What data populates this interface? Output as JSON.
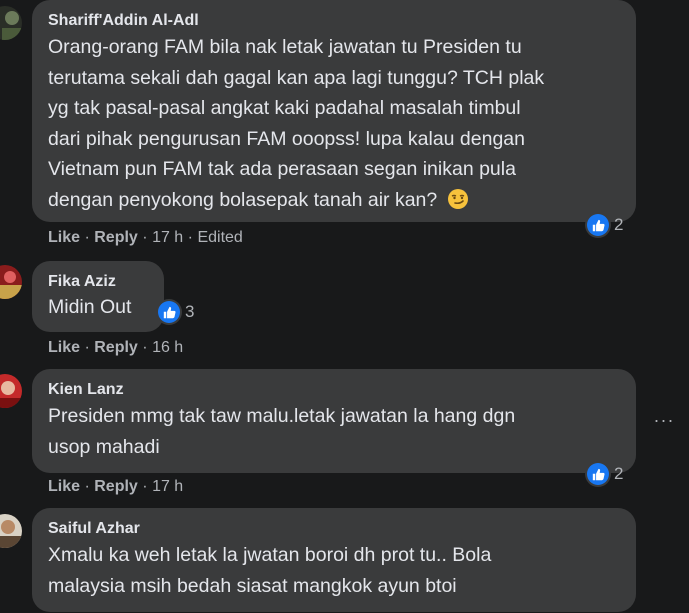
{
  "comments": [
    {
      "author": "Shariff'Addin Al-Adl",
      "lines": [
        "Orang-orang FAM bila nak letak jawatan tu Presiden tu",
        "terutama sekali dah gagal kan apa lagi tunggu? TCH plak",
        "yg tak pasal-pasal angkat kaki padahal masalah timbul",
        "dari pihak pengurusan FAM ooopss! lupa kalau dengan",
        "Vietnam pun FAM tak ada perasaan segan inikan pula",
        "dengan penyokong bolasepak tanah air kan?"
      ],
      "emoji": "smirk-emoji",
      "reaction_icon": "thumbs-up-icon",
      "reaction_count": "2",
      "like": "Like",
      "reply": "Reply",
      "sep": "·",
      "time": "17 h",
      "edited": "Edited"
    },
    {
      "author": "Fika Aziz",
      "lines": [
        "Midin Out"
      ],
      "reaction_icon": "thumbs-up-icon",
      "reaction_count": "3",
      "like": "Like",
      "reply": "Reply",
      "sep": "·",
      "time": "16 h"
    },
    {
      "author": "Kien Lanz",
      "lines": [
        "Presiden mmg tak taw malu.letak jawatan la hang dgn",
        "usop mahadi"
      ],
      "reaction_icon": "thumbs-up-icon",
      "reaction_count": "2",
      "like": "Like",
      "reply": "Reply",
      "sep": "·",
      "time": "17 h",
      "more_label": "···"
    },
    {
      "author": "Saiful Azhar",
      "lines": [
        "Xmalu ka weh letak la jwatan boroi dh prot tu.. Bola",
        "malaysia msih bedah siasat mangkok ayun btoi"
      ]
    }
  ],
  "colors": {
    "background": "#18191a",
    "bubble": "#3a3b3c",
    "text": "#e4e6eb",
    "muted": "#b0b3b8",
    "like_blue": "#1877f2"
  }
}
